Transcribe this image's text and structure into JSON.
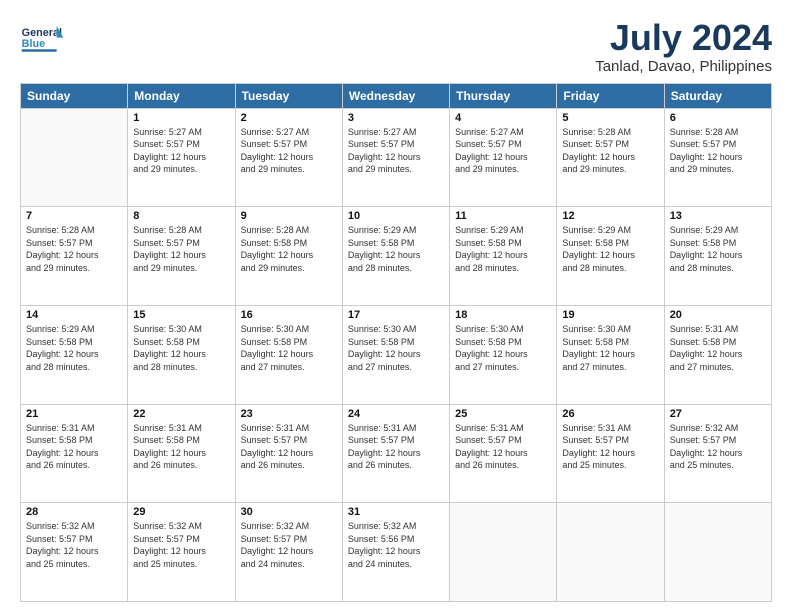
{
  "header": {
    "logo_general": "General",
    "logo_blue": "Blue",
    "title": "July 2024",
    "subtitle": "Tanlad, Davao, Philippines"
  },
  "calendar": {
    "days_of_week": [
      "Sunday",
      "Monday",
      "Tuesday",
      "Wednesday",
      "Thursday",
      "Friday",
      "Saturday"
    ],
    "weeks": [
      [
        {
          "day": "",
          "info": ""
        },
        {
          "day": "1",
          "info": "Sunrise: 5:27 AM\nSunset: 5:57 PM\nDaylight: 12 hours\nand 29 minutes."
        },
        {
          "day": "2",
          "info": "Sunrise: 5:27 AM\nSunset: 5:57 PM\nDaylight: 12 hours\nand 29 minutes."
        },
        {
          "day": "3",
          "info": "Sunrise: 5:27 AM\nSunset: 5:57 PM\nDaylight: 12 hours\nand 29 minutes."
        },
        {
          "day": "4",
          "info": "Sunrise: 5:27 AM\nSunset: 5:57 PM\nDaylight: 12 hours\nand 29 minutes."
        },
        {
          "day": "5",
          "info": "Sunrise: 5:28 AM\nSunset: 5:57 PM\nDaylight: 12 hours\nand 29 minutes."
        },
        {
          "day": "6",
          "info": "Sunrise: 5:28 AM\nSunset: 5:57 PM\nDaylight: 12 hours\nand 29 minutes."
        }
      ],
      [
        {
          "day": "7",
          "info": "Sunrise: 5:28 AM\nSunset: 5:57 PM\nDaylight: 12 hours\nand 29 minutes."
        },
        {
          "day": "8",
          "info": "Sunrise: 5:28 AM\nSunset: 5:57 PM\nDaylight: 12 hours\nand 29 minutes."
        },
        {
          "day": "9",
          "info": "Sunrise: 5:28 AM\nSunset: 5:58 PM\nDaylight: 12 hours\nand 29 minutes."
        },
        {
          "day": "10",
          "info": "Sunrise: 5:29 AM\nSunset: 5:58 PM\nDaylight: 12 hours\nand 28 minutes."
        },
        {
          "day": "11",
          "info": "Sunrise: 5:29 AM\nSunset: 5:58 PM\nDaylight: 12 hours\nand 28 minutes."
        },
        {
          "day": "12",
          "info": "Sunrise: 5:29 AM\nSunset: 5:58 PM\nDaylight: 12 hours\nand 28 minutes."
        },
        {
          "day": "13",
          "info": "Sunrise: 5:29 AM\nSunset: 5:58 PM\nDaylight: 12 hours\nand 28 minutes."
        }
      ],
      [
        {
          "day": "14",
          "info": "Sunrise: 5:29 AM\nSunset: 5:58 PM\nDaylight: 12 hours\nand 28 minutes."
        },
        {
          "day": "15",
          "info": "Sunrise: 5:30 AM\nSunset: 5:58 PM\nDaylight: 12 hours\nand 28 minutes."
        },
        {
          "day": "16",
          "info": "Sunrise: 5:30 AM\nSunset: 5:58 PM\nDaylight: 12 hours\nand 27 minutes."
        },
        {
          "day": "17",
          "info": "Sunrise: 5:30 AM\nSunset: 5:58 PM\nDaylight: 12 hours\nand 27 minutes."
        },
        {
          "day": "18",
          "info": "Sunrise: 5:30 AM\nSunset: 5:58 PM\nDaylight: 12 hours\nand 27 minutes."
        },
        {
          "day": "19",
          "info": "Sunrise: 5:30 AM\nSunset: 5:58 PM\nDaylight: 12 hours\nand 27 minutes."
        },
        {
          "day": "20",
          "info": "Sunrise: 5:31 AM\nSunset: 5:58 PM\nDaylight: 12 hours\nand 27 minutes."
        }
      ],
      [
        {
          "day": "21",
          "info": "Sunrise: 5:31 AM\nSunset: 5:58 PM\nDaylight: 12 hours\nand 26 minutes."
        },
        {
          "day": "22",
          "info": "Sunrise: 5:31 AM\nSunset: 5:58 PM\nDaylight: 12 hours\nand 26 minutes."
        },
        {
          "day": "23",
          "info": "Sunrise: 5:31 AM\nSunset: 5:57 PM\nDaylight: 12 hours\nand 26 minutes."
        },
        {
          "day": "24",
          "info": "Sunrise: 5:31 AM\nSunset: 5:57 PM\nDaylight: 12 hours\nand 26 minutes."
        },
        {
          "day": "25",
          "info": "Sunrise: 5:31 AM\nSunset: 5:57 PM\nDaylight: 12 hours\nand 26 minutes."
        },
        {
          "day": "26",
          "info": "Sunrise: 5:31 AM\nSunset: 5:57 PM\nDaylight: 12 hours\nand 25 minutes."
        },
        {
          "day": "27",
          "info": "Sunrise: 5:32 AM\nSunset: 5:57 PM\nDaylight: 12 hours\nand 25 minutes."
        }
      ],
      [
        {
          "day": "28",
          "info": "Sunrise: 5:32 AM\nSunset: 5:57 PM\nDaylight: 12 hours\nand 25 minutes."
        },
        {
          "day": "29",
          "info": "Sunrise: 5:32 AM\nSunset: 5:57 PM\nDaylight: 12 hours\nand 25 minutes."
        },
        {
          "day": "30",
          "info": "Sunrise: 5:32 AM\nSunset: 5:57 PM\nDaylight: 12 hours\nand 24 minutes."
        },
        {
          "day": "31",
          "info": "Sunrise: 5:32 AM\nSunset: 5:56 PM\nDaylight: 12 hours\nand 24 minutes."
        },
        {
          "day": "",
          "info": ""
        },
        {
          "day": "",
          "info": ""
        },
        {
          "day": "",
          "info": ""
        }
      ]
    ]
  }
}
